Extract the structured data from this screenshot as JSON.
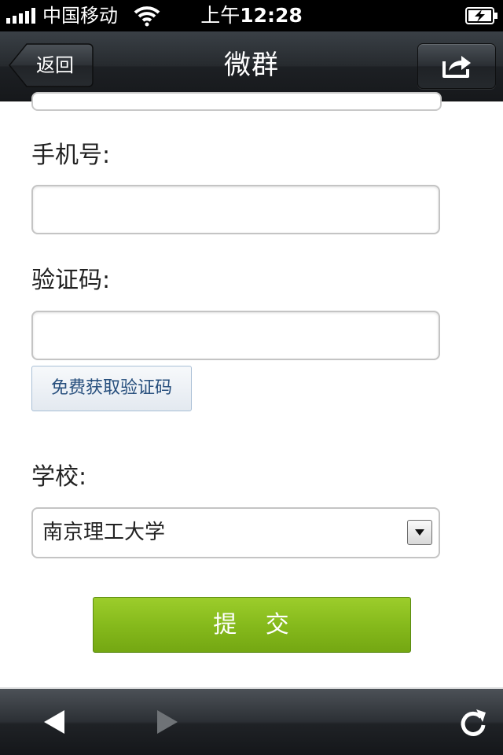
{
  "status_bar": {
    "carrier": "中国移动",
    "time_prefix": "上午",
    "time": "12:28",
    "icons": [
      "signal-strength-icon",
      "wifi-icon",
      "battery-charging-icon"
    ]
  },
  "nav": {
    "back_label": "返回",
    "title": "微群",
    "share_icon": "share-icon"
  },
  "form": {
    "phone_label": "手机号:",
    "phone_value": "",
    "code_label": "验证码:",
    "code_value": "",
    "get_code_label": "免费获取验证码",
    "school_label": "学校:",
    "school_value": "南京理工大学",
    "submit_label": "提   交"
  },
  "toolbar": {
    "icons": [
      "back-arrow-icon",
      "forward-arrow-icon",
      "refresh-icon"
    ]
  },
  "colors": {
    "submit_green": "#86ba1c",
    "link_blue": "#274f7d",
    "nav_dark": "#262a2e"
  }
}
